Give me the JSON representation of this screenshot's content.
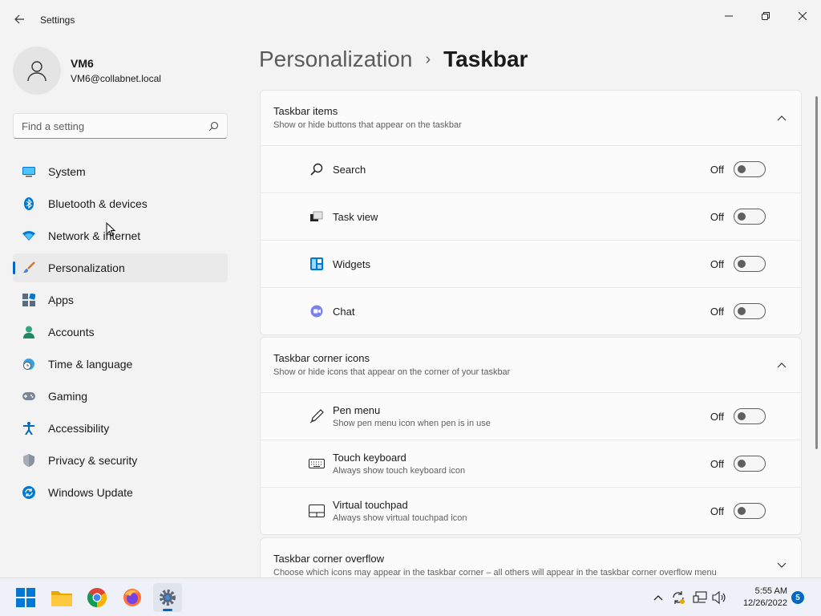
{
  "window": {
    "title": "Settings"
  },
  "profile": {
    "name": "VM6",
    "email": "VM6@collabnet.local"
  },
  "search": {
    "placeholder": "Find a setting"
  },
  "sidebar": {
    "items": [
      {
        "label": "System",
        "icon": "monitor-icon"
      },
      {
        "label": "Bluetooth & devices",
        "icon": "bluetooth-icon"
      },
      {
        "label": "Network & internet",
        "icon": "wifi-icon"
      },
      {
        "label": "Personalization",
        "icon": "brush-icon",
        "active": true
      },
      {
        "label": "Apps",
        "icon": "apps-icon"
      },
      {
        "label": "Accounts",
        "icon": "person-icon"
      },
      {
        "label": "Time & language",
        "icon": "clock-globe-icon"
      },
      {
        "label": "Gaming",
        "icon": "gamepad-icon"
      },
      {
        "label": "Accessibility",
        "icon": "accessibility-icon"
      },
      {
        "label": "Privacy & security",
        "icon": "shield-icon"
      },
      {
        "label": "Windows Update",
        "icon": "update-icon"
      }
    ]
  },
  "breadcrumb": {
    "parent": "Personalization",
    "separator": "›",
    "current": "Taskbar"
  },
  "groups": {
    "taskbar_items": {
      "title": "Taskbar items",
      "desc": "Show or hide buttons that appear on the taskbar",
      "rows": [
        {
          "title": "Search",
          "state": "Off",
          "icon": "search-icon"
        },
        {
          "title": "Task view",
          "state": "Off",
          "icon": "task-view-icon"
        },
        {
          "title": "Widgets",
          "state": "Off",
          "icon": "widgets-icon"
        },
        {
          "title": "Chat",
          "state": "Off",
          "icon": "chat-icon"
        }
      ]
    },
    "corner_icons": {
      "title": "Taskbar corner icons",
      "desc": "Show or hide icons that appear on the corner of your taskbar",
      "rows": [
        {
          "title": "Pen menu",
          "sub": "Show pen menu icon when pen is in use",
          "state": "Off",
          "icon": "pen-icon"
        },
        {
          "title": "Touch keyboard",
          "sub": "Always show touch keyboard icon",
          "state": "Off",
          "icon": "keyboard-icon"
        },
        {
          "title": "Virtual touchpad",
          "sub": "Always show virtual touchpad icon",
          "state": "Off",
          "icon": "touchpad-icon"
        }
      ]
    },
    "corner_overflow": {
      "title": "Taskbar corner overflow",
      "desc": "Choose which icons may appear in the taskbar corner – all others will appear in the taskbar corner overflow menu"
    }
  },
  "taskbar": {
    "time": "5:55 AM",
    "date": "12/26/2022",
    "notifications": "5"
  },
  "colors": {
    "accent": "#0067c0",
    "background": "#f3f3f3",
    "card": "#fbfbfb"
  }
}
